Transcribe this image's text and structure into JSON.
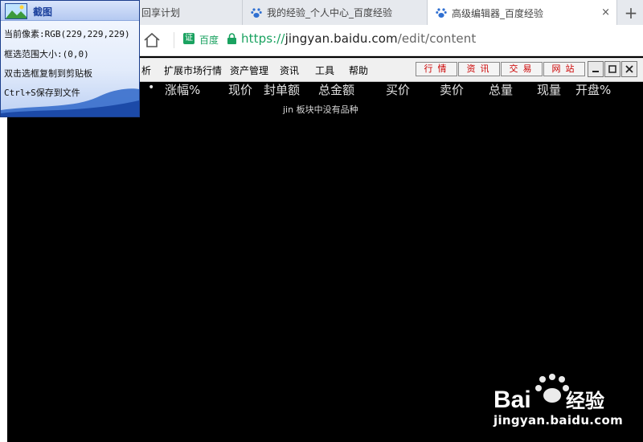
{
  "browser": {
    "tabs": [
      {
        "label": "回享计划",
        "active": false
      },
      {
        "label": "我的经验_个人中心_百度经验",
        "active": false
      },
      {
        "label": "高级编辑器_百度经验",
        "active": true
      }
    ],
    "cert_badge": "证",
    "cert_name": "百度",
    "url_scheme": "https://",
    "url_host": "jingyan.baidu.com",
    "url_path": "/edit/content",
    "close_glyph": "×",
    "new_tab_glyph": "+"
  },
  "stock_app": {
    "menu": [
      "析",
      "扩展市场行情",
      "资产管理",
      "资讯",
      "工具",
      "帮助"
    ],
    "quick_buttons": [
      "行情",
      "资讯",
      "交易",
      "网站"
    ],
    "window_buttons": [
      "minimize",
      "maximize",
      "close"
    ],
    "bullet": "•",
    "columns": [
      "涨幅%",
      "现价",
      "封单额",
      "总金额",
      "买价",
      "卖价",
      "总量",
      "现量",
      "开盘%"
    ],
    "empty_message": "jin 板块中没有品种"
  },
  "capture_tool": {
    "title": "截图",
    "pixel_label": "当前像素:RGB(229,229,229)",
    "range_label": "框选范围大小:(0,0)",
    "copy_hint": "双击选框复制到剪贴板",
    "save_hint": "Ctrl+S保存到文件"
  },
  "watermark": {
    "brand": "Bai",
    "brand_suffix": "经验",
    "domain": "jingyan.baidu.com"
  }
}
